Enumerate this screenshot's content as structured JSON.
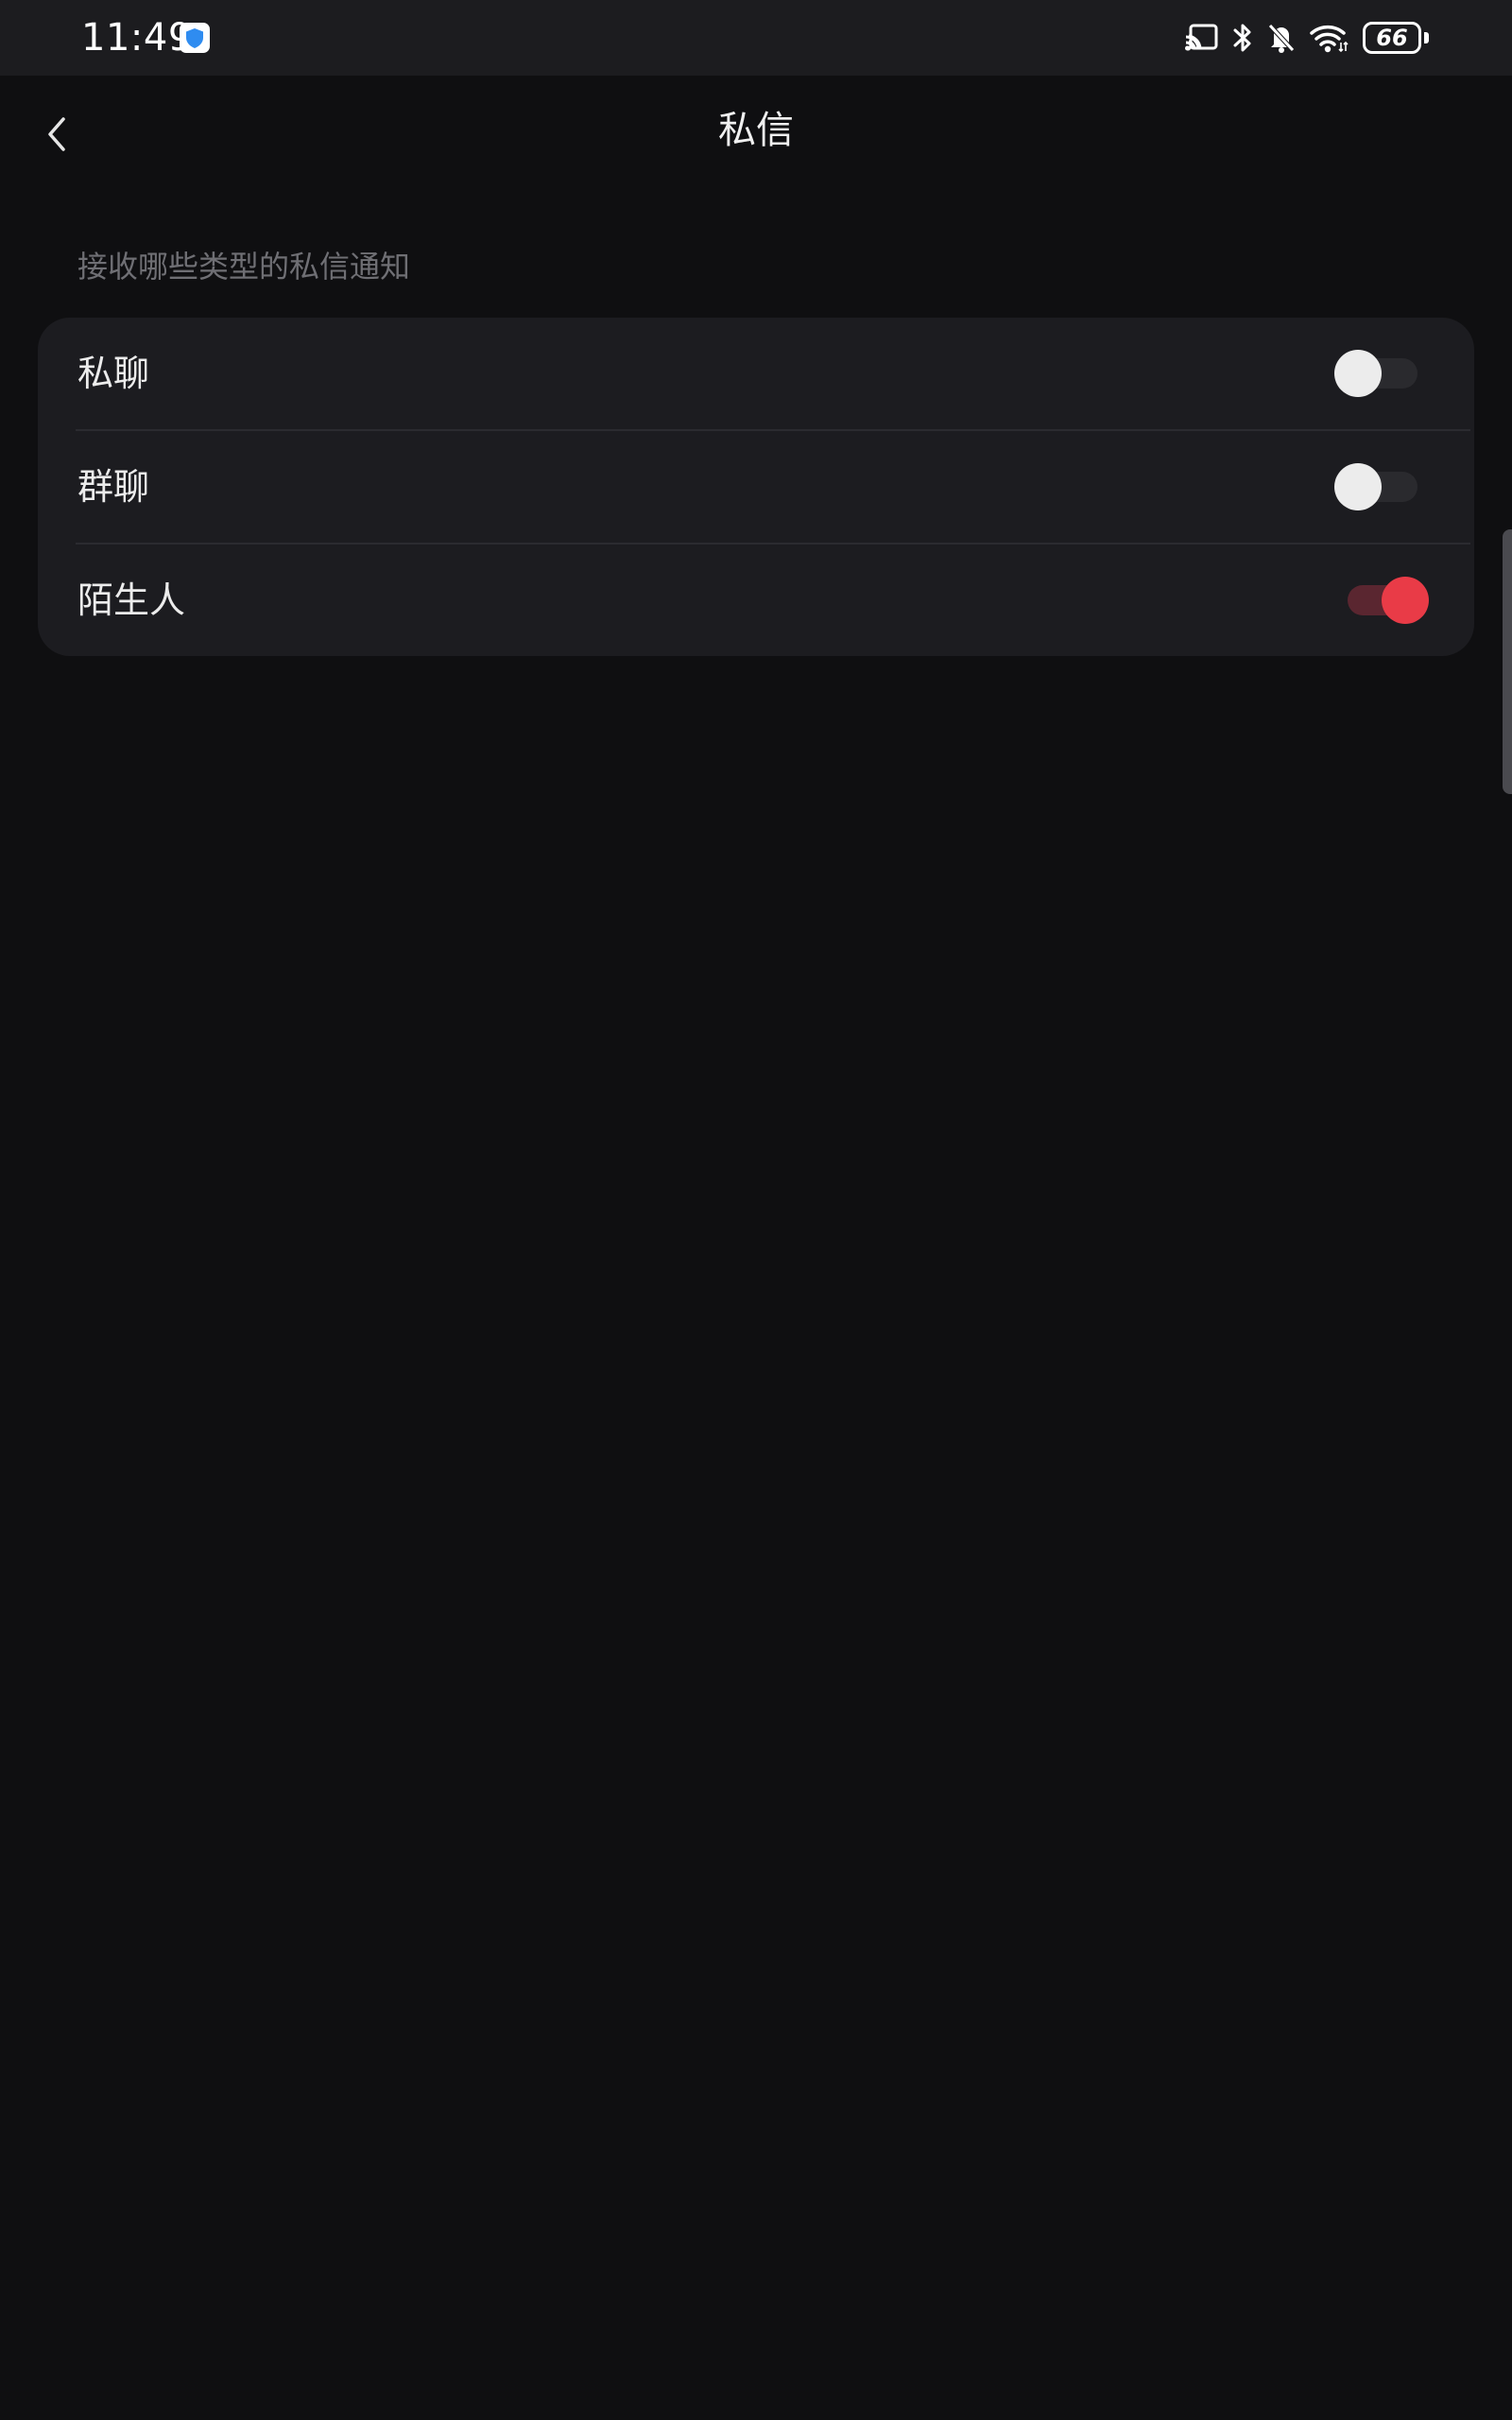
{
  "status_bar": {
    "time": "11:49",
    "battery": "66",
    "icons": [
      "shield-app-icon",
      "cast-icon",
      "bluetooth-icon",
      "bell-off-icon",
      "wifi-icon",
      "battery-icon"
    ]
  },
  "header": {
    "title": "私信",
    "back_icon": "chevron-left-icon"
  },
  "section": {
    "caption": "接收哪些类型的私信通知",
    "items": [
      {
        "label": "私聊",
        "enabled": false
      },
      {
        "label": "群聊",
        "enabled": false
      },
      {
        "label": "陌生人",
        "enabled": true
      }
    ]
  },
  "colors": {
    "background": "#0f0f11",
    "card": "#1c1c20",
    "accent": "#e93b47",
    "caption": "#6f6f74"
  }
}
